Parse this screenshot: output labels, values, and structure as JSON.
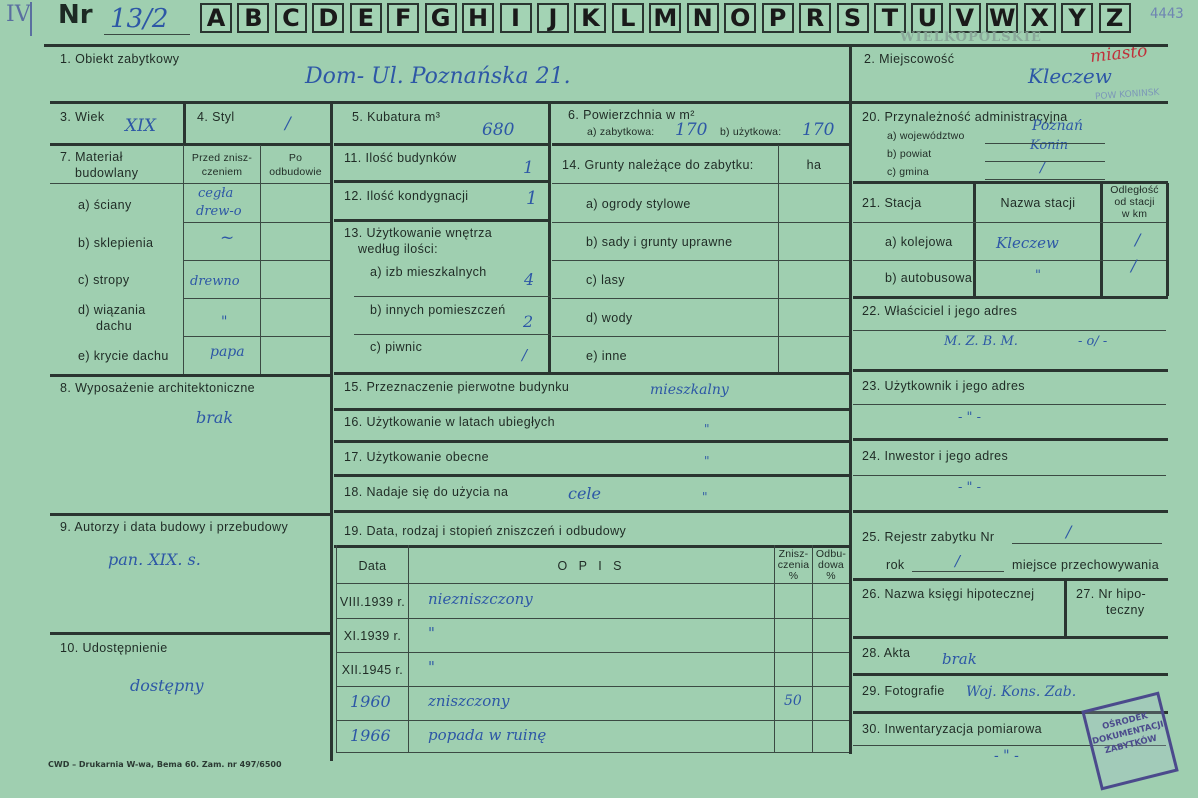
{
  "header": {
    "roman": "IV",
    "nr_label": "Nr",
    "nr_value": "13/2",
    "letters": [
      "A",
      "B",
      "C",
      "D",
      "E",
      "F",
      "G",
      "H",
      "I",
      "J",
      "K",
      "L",
      "M",
      "N",
      "O",
      "P",
      "R",
      "S",
      "T",
      "U",
      "V",
      "W",
      "X",
      "Y",
      "Z"
    ],
    "corner_number": "4443",
    "region_stamp": "WIELKOPOLSKIE",
    "region_note": "miasto",
    "region_note2": "POW KONINSK"
  },
  "fields": {
    "f1_label": "1. Obiekt zabytkowy",
    "f1_value": "Dom- Ul. Poznańska 21.",
    "f2_label": "2. Miejscowość",
    "f2_value": "Kleczew",
    "f3_label": "3. Wiek",
    "f3_value": "XIX",
    "f4_label": "4. Styl",
    "f4_value": "/",
    "f5_label": "5. Kubatura m³",
    "f5_value": "680",
    "f6_label": "6. Powierzchnia w m²",
    "f6a_label": "a) zabytkowa:",
    "f6a_value": "170",
    "f6b_label": "b) użytkowa:",
    "f6b_value": "170",
    "f20_label": "20. Przynależność administracyjna",
    "f20a_label": "a) województwo",
    "f20a_value": "Poznań",
    "f20b_label": "b) powiat",
    "f20b_value": "Konin",
    "f20c_label": "c) gmina",
    "f20c_value": "/",
    "f7_label_1": "7. Materiał",
    "f7_label_2": "budowlany",
    "f7_col_przed_1": "Przed znisz-",
    "f7_col_przed_2": "czeniem",
    "f7_col_po_1": "Po",
    "f7_col_po_2": "odbudowie",
    "f7a_label": "a) ściany",
    "f7a_value_1": "cegła",
    "f7a_value_2": "drew-o",
    "f7b_label": "b) sklepienia",
    "f7b_value": "~",
    "f7c_label": "c) stropy",
    "f7c_value": "drewno",
    "f7d_label_1": "d) wiązania",
    "f7d_label_2": "dachu",
    "f7d_value": "\"",
    "f7e_label": "e) krycie dachu",
    "f7e_value": "papa",
    "f11_label": "11. Ilość budynków",
    "f11_value": "1",
    "f12_label": "12. Ilość kondygnacji",
    "f12_value": "1",
    "f13_label_1": "13. Użytkowanie wnętrza",
    "f13_label_2": "według ilości:",
    "f13a_label": "a) izb mieszkalnych",
    "f13a_value": "4",
    "f13b_label": "b) innych pomieszczeń",
    "f13b_value": "2",
    "f13c_label": "c) piwnic",
    "f13c_value": "/",
    "f14_label": "14. Grunty należące do zabytku:",
    "f14_unit": "ha",
    "f14a_label": "a) ogrody stylowe",
    "f14b_label": "b) sady i grunty uprawne",
    "f14c_label": "c) lasy",
    "f14d_label": "d) wody",
    "f14e_label": "e) inne",
    "f21_label": "21. Stacja",
    "f21_col_name": "Nazwa stacji",
    "f21_col_dist_1": "Odległość",
    "f21_col_dist_2": "od stacji",
    "f21_col_dist_3": "w km",
    "f21a_label": "a) kolejowa",
    "f21a_name": "Kleczew",
    "f21a_dist": "/",
    "f21b_label": "b) autobusowa",
    "f21b_name": "\"",
    "f21b_dist": "/",
    "f22_label": "22. Właściciel i jego adres",
    "f22_value": "M. Z. B. M.",
    "f22_value2": "- o/ -",
    "f8_label": "8. Wyposażenie architektoniczne",
    "f8_value": "brak",
    "f15_label": "15. Przeznaczenie pierwotne budynku",
    "f15_value": "mieszkalny",
    "f16_label": "16. Użytkowanie w latach ubiegłych",
    "f16_value": "\"",
    "f17_label": "17. Użytkowanie obecne",
    "f17_value": "\"",
    "f18_label": "18. Nadaje się do użycia na",
    "f18_value": "cele",
    "f18_value2": "\"",
    "f23_label": "23. Użytkownik i jego adres",
    "f23_value": "- \" -",
    "f24_label": "24. Inwestor i jego adres",
    "f24_value": "- \" -",
    "f9_label": "9. Autorzy i data budowy i przebudowy",
    "f9_value": "pan. XIX. s.",
    "f19_label": "19. Data, rodzaj i stopień zniszczeń i odbudowy",
    "f19_col_data": "Data",
    "f19_col_opis": "O P I S",
    "f19_col_znisz_1": "Znisz-",
    "f19_col_znisz_2": "czenia",
    "f19_col_znisz_3": "%",
    "f19_col_odbud_1": "Odbu-",
    "f19_col_odbud_2": "dowa",
    "f19_col_odbud_3": "%",
    "f25_label": "25. Rejestr zabytku Nr",
    "f25_value": "/",
    "f25_rok_label": "rok",
    "f25_rok_value": "/",
    "f25_miejsce_label": "miejsce przechowywania",
    "f26_label": "26. Nazwa księgi hipotecznej",
    "f27_label_1": "27. Nr hipo-",
    "f27_label_2": "teczny",
    "f10_label": "10. Udostępnienie",
    "f10_value": "dostępny",
    "f28_label": "28. Akta",
    "f28_value": "brak",
    "f29_label": "29. Fotografie",
    "f29_value": "Woj. Kons. Zab.",
    "f30_label": "30. Inwentaryzacja pomiarowa",
    "f30_value": "- \" -"
  },
  "f19_rows": [
    {
      "date": "VIII.1939 r.",
      "opis": "niezniszczony",
      "znisz": "",
      "odbud": ""
    },
    {
      "date": "XI.1939 r.",
      "opis": "\"",
      "znisz": "",
      "odbud": ""
    },
    {
      "date": "XII.1945 r.",
      "opis": "\"",
      "znisz": "",
      "odbud": ""
    },
    {
      "date": "1960",
      "opis": "zniszczony",
      "znisz": "50",
      "odbud": ""
    },
    {
      "date": "1966",
      "opis": "popada w ruinę",
      "znisz": "",
      "odbud": ""
    }
  ],
  "footer": {
    "printer": "CWD – Drukarnia W-wa, Bema 60. Zam. nr 497/6500"
  },
  "stamp": {
    "line1": "OŚRODEK",
    "line2": "DOKUMENTACJI",
    "line3": "ZABYTKÓW"
  },
  "colors": {
    "card": "#9fcfb0",
    "ink": "#2d57a6",
    "stamp": "#4b4a8c"
  }
}
